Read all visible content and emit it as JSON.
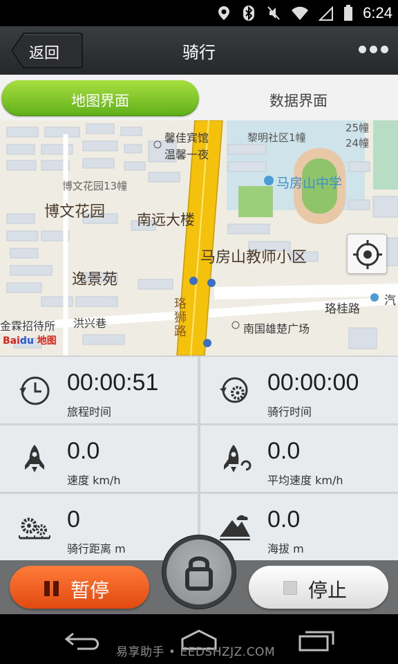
{
  "status_bar": {
    "time": "6:24"
  },
  "header": {
    "back_label": "返回",
    "title": "骑行"
  },
  "tabs": [
    {
      "label": "地图界面",
      "active": true
    },
    {
      "label": "数据界面",
      "active": false
    }
  ],
  "map": {
    "labels": {
      "xinjia": "馨佳宾馆",
      "wenxin": "温馨一夜",
      "liming": "黎明社区1幢",
      "b25": "25幢",
      "b24": "24幢",
      "mfs_school": "马房山中学",
      "bowen13": "博文花园13幢",
      "bowen": "博文花园",
      "nanyuan": "南远大楼",
      "teacher": "马房山教师小区",
      "yijing": "逸景苑",
      "luogui": "珞桂路",
      "qi": "汽",
      "luoshi": "珞狮路",
      "jinlin": "金霖招待所",
      "hongxing": "洪兴巷",
      "nanguo": "南国雄楚广场",
      "baidu_text": "地图"
    }
  },
  "stats": [
    {
      "value": "00:00:51",
      "label": "旅程时间",
      "icon": "clock-icon"
    },
    {
      "value": "00:00:00",
      "label": "骑行时间",
      "icon": "gear-clock-icon"
    },
    {
      "value": "0.0",
      "label": "速度 km/h",
      "icon": "rocket-icon"
    },
    {
      "value": "0.0",
      "label": "平均速度 km/h",
      "icon": "rocket-avg-icon"
    },
    {
      "value": "0",
      "label": "骑行距离  m",
      "icon": "gears-distance-icon"
    },
    {
      "value": "0.0",
      "label": "海拔 m",
      "icon": "mountain-icon"
    }
  ],
  "controls": {
    "pause_label": "暂停",
    "stop_label": "停止"
  },
  "navbar": {
    "watermark": "易享助手 • EEDSHZJZ.COM"
  },
  "colors": {
    "accent_green": "#6cbb20",
    "pause_orange": "#f05a1c",
    "map_road": "#f4c20d"
  }
}
